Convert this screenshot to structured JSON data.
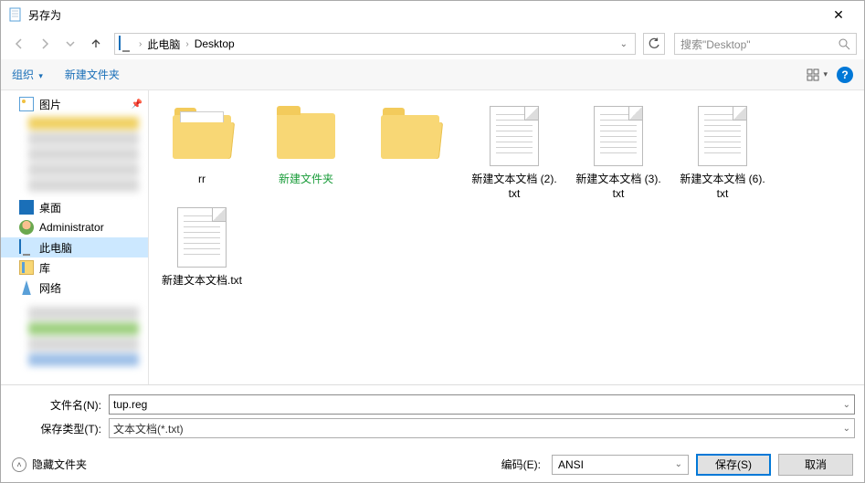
{
  "title": "另存为",
  "nav": {
    "crumbs": [
      "此电脑",
      "Desktop"
    ],
    "search_placeholder": "搜索\"Desktop\""
  },
  "toolbar": {
    "organize": "组织",
    "newfolder": "新建文件夹"
  },
  "sidebar": {
    "pictures": "图片",
    "desktop": "桌面",
    "admin": "Administrator",
    "thispc": "此电脑",
    "libraries": "库",
    "network": "网络"
  },
  "items": [
    {
      "name": "rr",
      "type": "folder-open"
    },
    {
      "name": "新建文件夹",
      "type": "folder",
      "selected": true
    },
    {
      "name": "",
      "type": "folder-preview"
    },
    {
      "name": "新建文本文档 (2).txt",
      "type": "txt"
    },
    {
      "name": "新建文本文档 (3).txt",
      "type": "txt"
    },
    {
      "name": "新建文本文档 (6).txt",
      "type": "txt"
    },
    {
      "name": "新建文本文档.txt",
      "type": "txt"
    }
  ],
  "form": {
    "filename_label": "文件名(N):",
    "filename_value": "tup.reg",
    "filetype_label": "保存类型(T):",
    "filetype_value": "文本文档(*.txt)"
  },
  "footer": {
    "hide": "隐藏文件夹",
    "encoding_label": "编码(E):",
    "encoding_value": "ANSI",
    "save": "保存(S)",
    "cancel": "取消"
  }
}
